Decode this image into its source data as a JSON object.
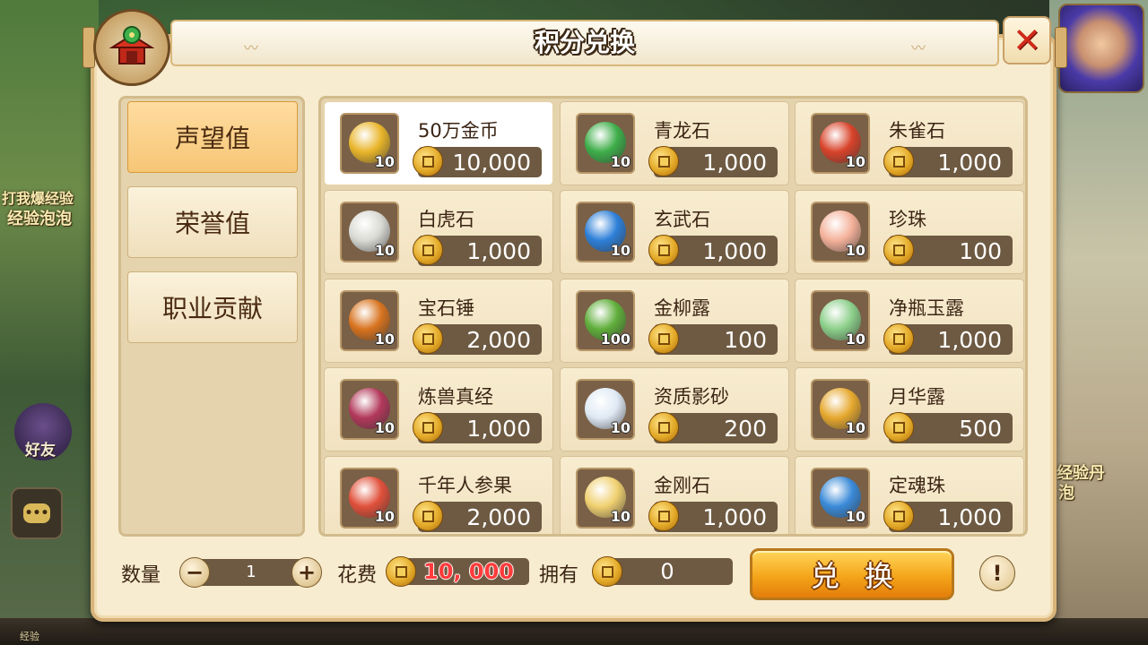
{
  "window": {
    "title": "积分兑换"
  },
  "background": {
    "left_text_1": "打我爆经验",
    "left_text_2": "经验泡泡",
    "friend_label": "好友",
    "right_text_1": "经验丹",
    "right_text_2": "泡",
    "bottom_label": "经验"
  },
  "tabs": [
    {
      "label": "声望值",
      "active": true
    },
    {
      "label": "荣誉值",
      "active": false
    },
    {
      "label": "职业贡献",
      "active": false
    }
  ],
  "items": [
    {
      "name": "50万金币",
      "count": "10",
      "price": "10,000",
      "icon": "gold-coin-icon",
      "color": "#e9b52a",
      "selected": true
    },
    {
      "name": "青龙石",
      "count": "10",
      "price": "1,000",
      "icon": "green-dragon-stone-icon",
      "color": "#3fae4a"
    },
    {
      "name": "朱雀石",
      "count": "10",
      "price": "1,000",
      "icon": "vermilion-bird-stone-icon",
      "color": "#d8432a"
    },
    {
      "name": "白虎石",
      "count": "10",
      "price": "1,000",
      "icon": "white-tiger-stone-icon",
      "color": "#d9d9d4"
    },
    {
      "name": "玄武石",
      "count": "10",
      "price": "1,000",
      "icon": "black-tortoise-stone-icon",
      "color": "#2d7fd8"
    },
    {
      "name": "珍珠",
      "count": "10",
      "price": "100",
      "icon": "pearl-icon",
      "color": "#f4b19a"
    },
    {
      "name": "宝石锤",
      "count": "10",
      "price": "2,000",
      "icon": "gem-hammer-icon",
      "color": "#d8731e"
    },
    {
      "name": "金柳露",
      "count": "100",
      "price": "100",
      "icon": "golden-willow-dew-icon",
      "color": "#5fae3a"
    },
    {
      "name": "净瓶玉露",
      "count": "10",
      "price": "1,000",
      "icon": "jade-vase-dew-icon",
      "color": "#8ccf8a"
    },
    {
      "name": "炼兽真经",
      "count": "10",
      "price": "1,000",
      "icon": "beast-scripture-icon",
      "color": "#b2385a"
    },
    {
      "name": "资质影砂",
      "count": "10",
      "price": "200",
      "icon": "aptitude-sand-icon",
      "color": "#dfe9f4"
    },
    {
      "name": "月华露",
      "count": "10",
      "price": "500",
      "icon": "moon-dew-gourd-icon",
      "color": "#e6a82e"
    },
    {
      "name": "千年人参果",
      "count": "10",
      "price": "2,000",
      "icon": "ginseng-fruit-icon",
      "color": "#e0503a"
    },
    {
      "name": "金刚石",
      "count": "10",
      "price": "1,000",
      "icon": "diamond-stone-icon",
      "color": "#f0d070"
    },
    {
      "name": "定魂珠",
      "count": "10",
      "price": "1,000",
      "icon": "soul-orb-icon",
      "color": "#3a8ad8"
    }
  ],
  "footer": {
    "qty_label": "数量",
    "qty_value": "1",
    "minus_symbol": "−",
    "plus_symbol": "+",
    "cost_label": "花费",
    "cost_value": "10, 000",
    "own_label": "拥有",
    "own_value": "0",
    "exchange_label": "兑换",
    "info_symbol": "!"
  },
  "close_symbol": "✕"
}
